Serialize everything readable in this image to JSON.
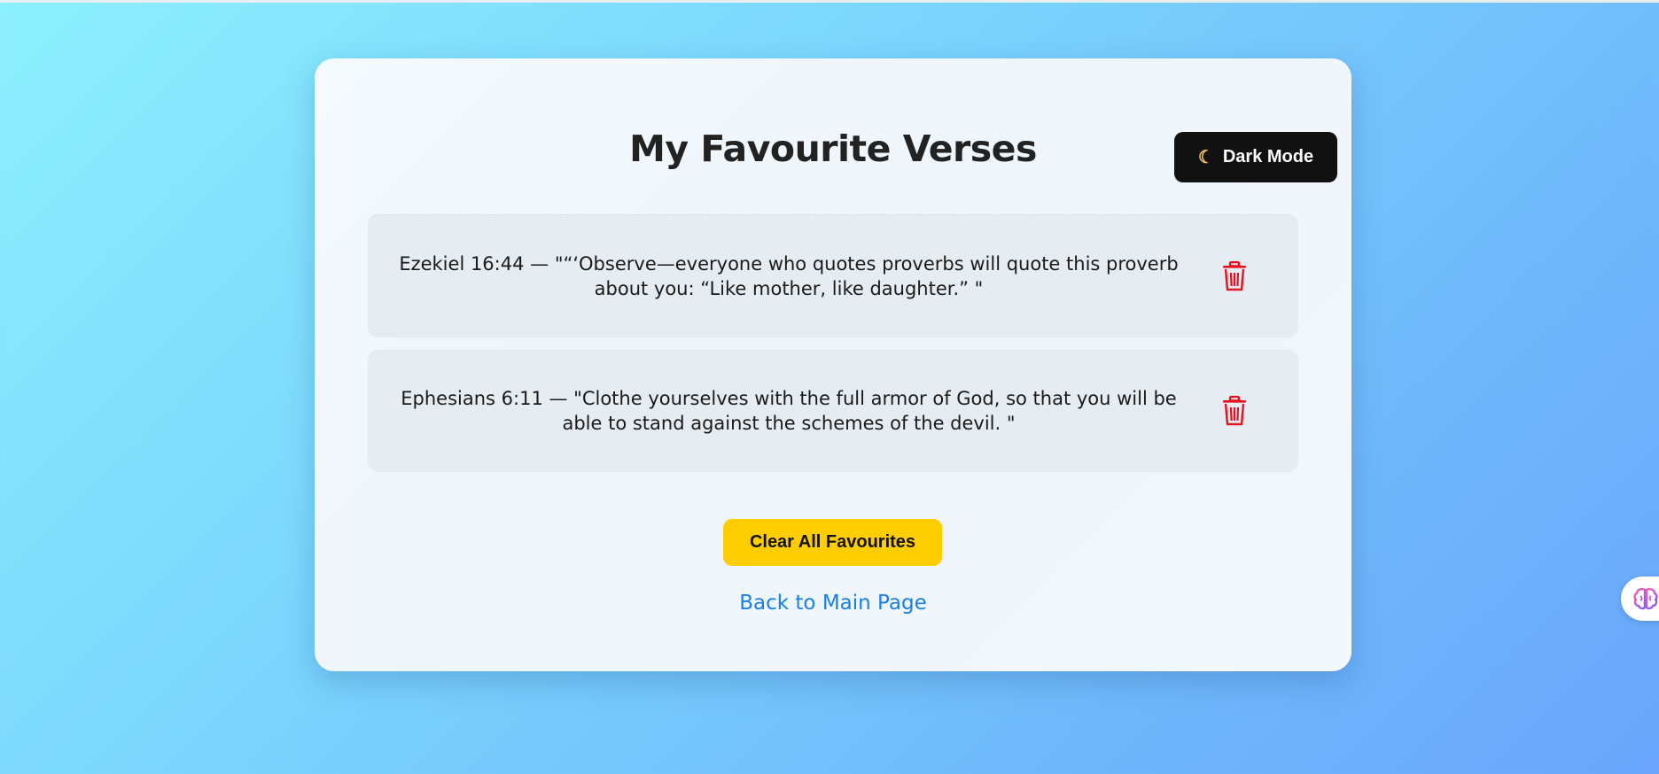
{
  "page": {
    "title": "My Favourite Verses"
  },
  "dark_mode_button": {
    "icon": "moon-icon",
    "label": "Dark Mode"
  },
  "verses": [
    {
      "text": "Ezekiel 16:44 — \"“‘Observe—everyone who quotes proverbs will quote this proverb about you: “Like mother, like daughter.” \"",
      "delete_icon": "trash-icon"
    },
    {
      "text": "Ephesians 6:11 — \"Clothe yourselves with the full armor of God, so that you will be able to stand against the schemes of the devil. \"",
      "delete_icon": "trash-icon"
    }
  ],
  "actions": {
    "clear_label": "Clear All Favourites",
    "back_label": "Back to Main Page"
  },
  "extension_widget": {
    "icon": "brain-icon"
  },
  "colors": {
    "accent_yellow": "#ffcd00",
    "link_blue": "#1a7fe6",
    "delete_red": "#e8101e",
    "dark_button": "#111111"
  }
}
